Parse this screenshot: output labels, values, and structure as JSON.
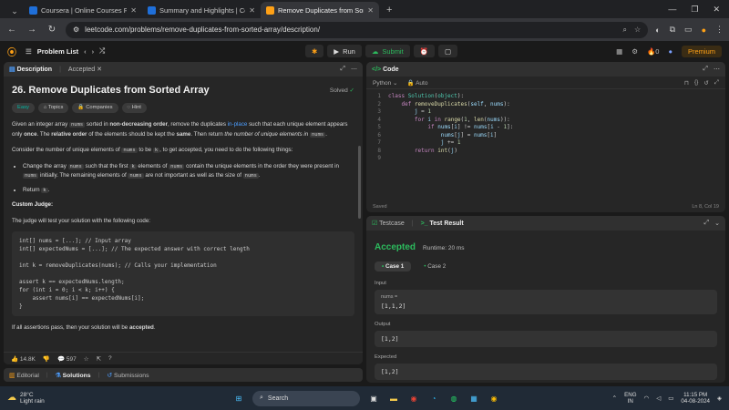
{
  "browser": {
    "tabs": [
      {
        "title": "Coursera | Online Courses From",
        "color": "#1f6fd9",
        "active": false
      },
      {
        "title": "Summary and Highlights | Cou",
        "color": "#1f6fd9",
        "active": false
      },
      {
        "title": "Remove Duplicates from Sorte",
        "color": "#ffa116",
        "active": true
      }
    ],
    "url": "leetcode.com/problems/remove-duplicates-from-sorted-array/description/"
  },
  "nav": {
    "problem_list": "Problem List",
    "run": "Run",
    "submit": "Submit",
    "streak": "0",
    "premium": "Premium"
  },
  "description": {
    "tabs": {
      "description": "Description",
      "accepted": "Accepted"
    },
    "title": "26. Remove Duplicates from Sorted Array",
    "solved": "Solved",
    "chips": {
      "easy": "Easy",
      "topics": "Topics",
      "companies": "Companies",
      "hint": "Hint"
    },
    "p1": {
      "a": "Given an integer array ",
      "code1": "nums",
      "b": " sorted in ",
      "bold1": "non-decreasing order",
      "c": ", remove the duplicates ",
      "link": "in-place",
      "d": " such that each unique element appears only ",
      "bold2": "once",
      "e": ". The ",
      "bold3": "relative order",
      "f": " of the elements should be kept the ",
      "bold4": "same",
      "g": ". Then return ",
      "ital": "the number of unique elements in",
      "code2": "nums",
      "h": "."
    },
    "p2": {
      "a": "Consider the number of unique elements of ",
      "code1": "nums",
      "b": " to be ",
      "code2": "k",
      "c": ", to get accepted, you need to do the following things:"
    },
    "li1": {
      "a": "Change the array ",
      "code1": "nums",
      "b": " such that the first ",
      "code2": "k",
      "c": " elements of ",
      "code3": "nums",
      "d": " contain the unique elements in the order they were present in ",
      "code4": "nums",
      "e": " initially. The remaining elements of ",
      "code5": "nums",
      "f": " are not important as well as the size of ",
      "code6": "nums",
      "g": "."
    },
    "li2": {
      "a": "Return ",
      "code1": "k",
      "b": "."
    },
    "judge_title": "Custom Judge:",
    "judge_text": "The judge will test your solution with the following code:",
    "judge_code": "int[] nums = [...]; // Input array\nint[] expectedNums = [...]; // The expected answer with correct length\n\nint k = removeDuplicates(nums); // Calls your implementation\n\nassert k == expectedNums.length;\nfor (int i = 0; i < k; i++) {\n    assert nums[i] == expectedNums[i];\n}",
    "final": {
      "a": "If all assertions pass, then your solution will be ",
      "bold": "accepted",
      "b": "."
    },
    "likes": "14.8K",
    "comments": "597"
  },
  "bottom_tabs": {
    "editorial": "Editorial",
    "solutions": "Solutions",
    "submissions": "Submissions"
  },
  "code": {
    "tab": "Code",
    "language": "Python",
    "auto": "Auto",
    "line_numbers": [
      "1",
      "2",
      "3",
      "4",
      "5",
      "6",
      "7",
      "8",
      "9"
    ],
    "saved": "Saved",
    "position": "Ln 8, Col 19"
  },
  "result": {
    "tabs": {
      "testcase": "Testcase",
      "result": "Test Result"
    },
    "status": "Accepted",
    "runtime": "Runtime: 20 ms",
    "cases": [
      "Case 1",
      "Case 2"
    ],
    "input_label": "Input",
    "input_var": "nums =",
    "input_value": "[1,1,2]",
    "output_label": "Output",
    "output_value": "[1,2]",
    "expected_label": "Expected",
    "expected_value": "[1,2]"
  },
  "taskbar": {
    "temp": "28°C",
    "weather": "Light rain",
    "search": "Search",
    "lang1": "ENG",
    "lang2": "IN",
    "time": "11:15 PM",
    "date": "04-08-2024"
  }
}
